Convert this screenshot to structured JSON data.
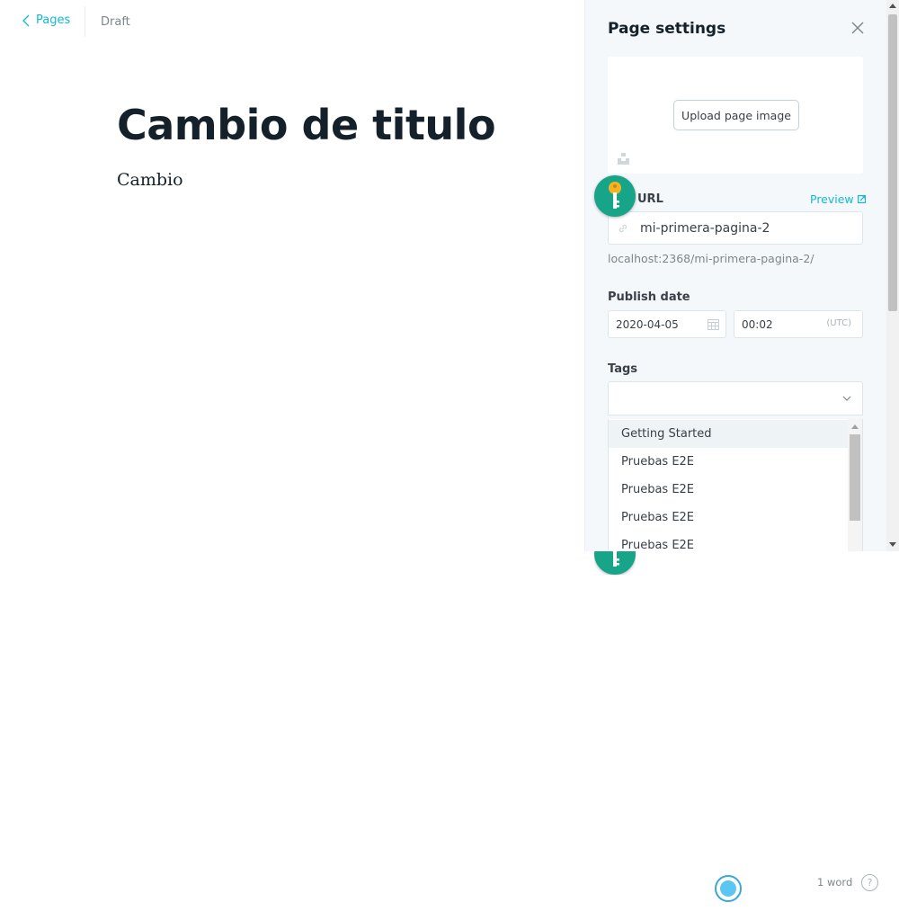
{
  "nav": {
    "back_label": "Pages",
    "status": "Draft"
  },
  "editor": {
    "title": "Cambio de titulo",
    "body": "Cambio"
  },
  "settings": {
    "title": "Page settings",
    "upload_label": "Upload page image",
    "url": {
      "label": "URL",
      "preview_label": "Preview",
      "value": "mi-primera-pagina-2",
      "full_url": "localhost:2368/mi-primera-pagina-2/"
    },
    "publish": {
      "label": "Publish date",
      "date": "2020-04-05",
      "time": "00:02",
      "timezone": "(UTC)"
    },
    "tags": {
      "label": "Tags",
      "value": "",
      "options": [
        "Getting Started",
        "Pruebas E2E",
        "Pruebas E2E",
        "Pruebas E2E",
        "Pruebas E2E"
      ]
    }
  },
  "footer": {
    "word_count": "1 word",
    "help": "?"
  },
  "colors": {
    "accent": "#14b8d6",
    "panel_bg": "#f4f8fb",
    "badge": "#17a589"
  }
}
